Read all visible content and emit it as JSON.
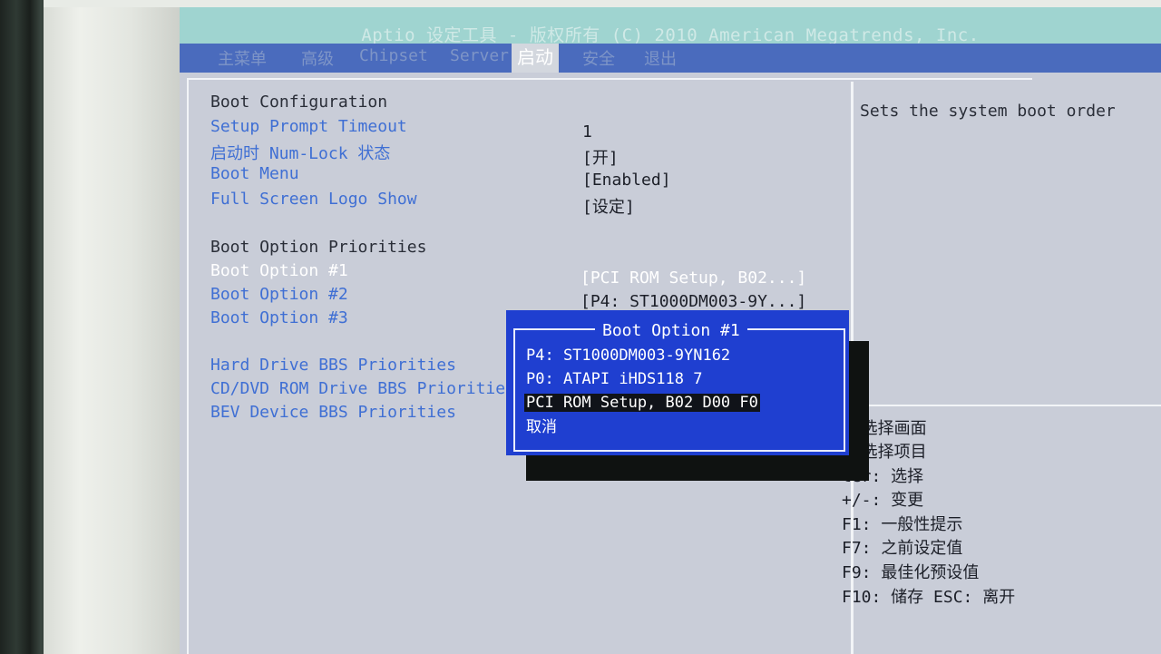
{
  "bios": {
    "title": "Aptio 设定工具 - 版权所有 (C) 2010 American Megatrends, Inc.",
    "tabs": [
      "主菜单",
      "高级",
      "Chipset",
      "Server",
      "启动",
      "安全",
      "退出"
    ],
    "active_tab": "启动"
  },
  "main": {
    "boot_config_header": "Boot Configuration",
    "setup_prompt_timeout": {
      "label": "Setup Prompt Timeout",
      "value": "1"
    },
    "numlock": {
      "label": "启动时 Num-Lock 状态",
      "value": "[开]"
    },
    "boot_menu": {
      "label": "Boot Menu",
      "value": "[Enabled]"
    },
    "full_screen_logo": {
      "label": "Full Screen Logo Show",
      "value": "[设定]"
    },
    "boot_option_priorities_header": "Boot Option Priorities",
    "boot_option_1": {
      "label": "Boot Option #1",
      "value": "[PCI ROM Setup, B02...]"
    },
    "boot_option_2": {
      "label": "Boot Option #2",
      "value": "[P4: ST1000DM003-9Y...]"
    },
    "boot_option_3": {
      "label": "Boot Option #3"
    },
    "hdd_bbs": "Hard Drive BBS Priorities",
    "cdrom_bbs": "CD/DVD ROM Drive BBS Prioritie",
    "bev_bbs": "BEV Device BBS Priorities"
  },
  "help": {
    "description": "Sets the system boot order",
    "keys": [
      ": 选择画面",
      ": 选择项目",
      "ter: 选择",
      "+/-: 变更",
      "F1: 一般性提示",
      "F7: 之前设定值",
      "F9: 最佳化预设值",
      "F10: 储存  ESC: 离开"
    ]
  },
  "popup": {
    "title": "Boot Option #1",
    "options": [
      "P4: ST1000DM003-9YN162",
      "P0: ATAPI   iHDS118   7",
      "PCI ROM Setup, B02 D00 F0",
      "取消"
    ],
    "selected_index": 2
  }
}
